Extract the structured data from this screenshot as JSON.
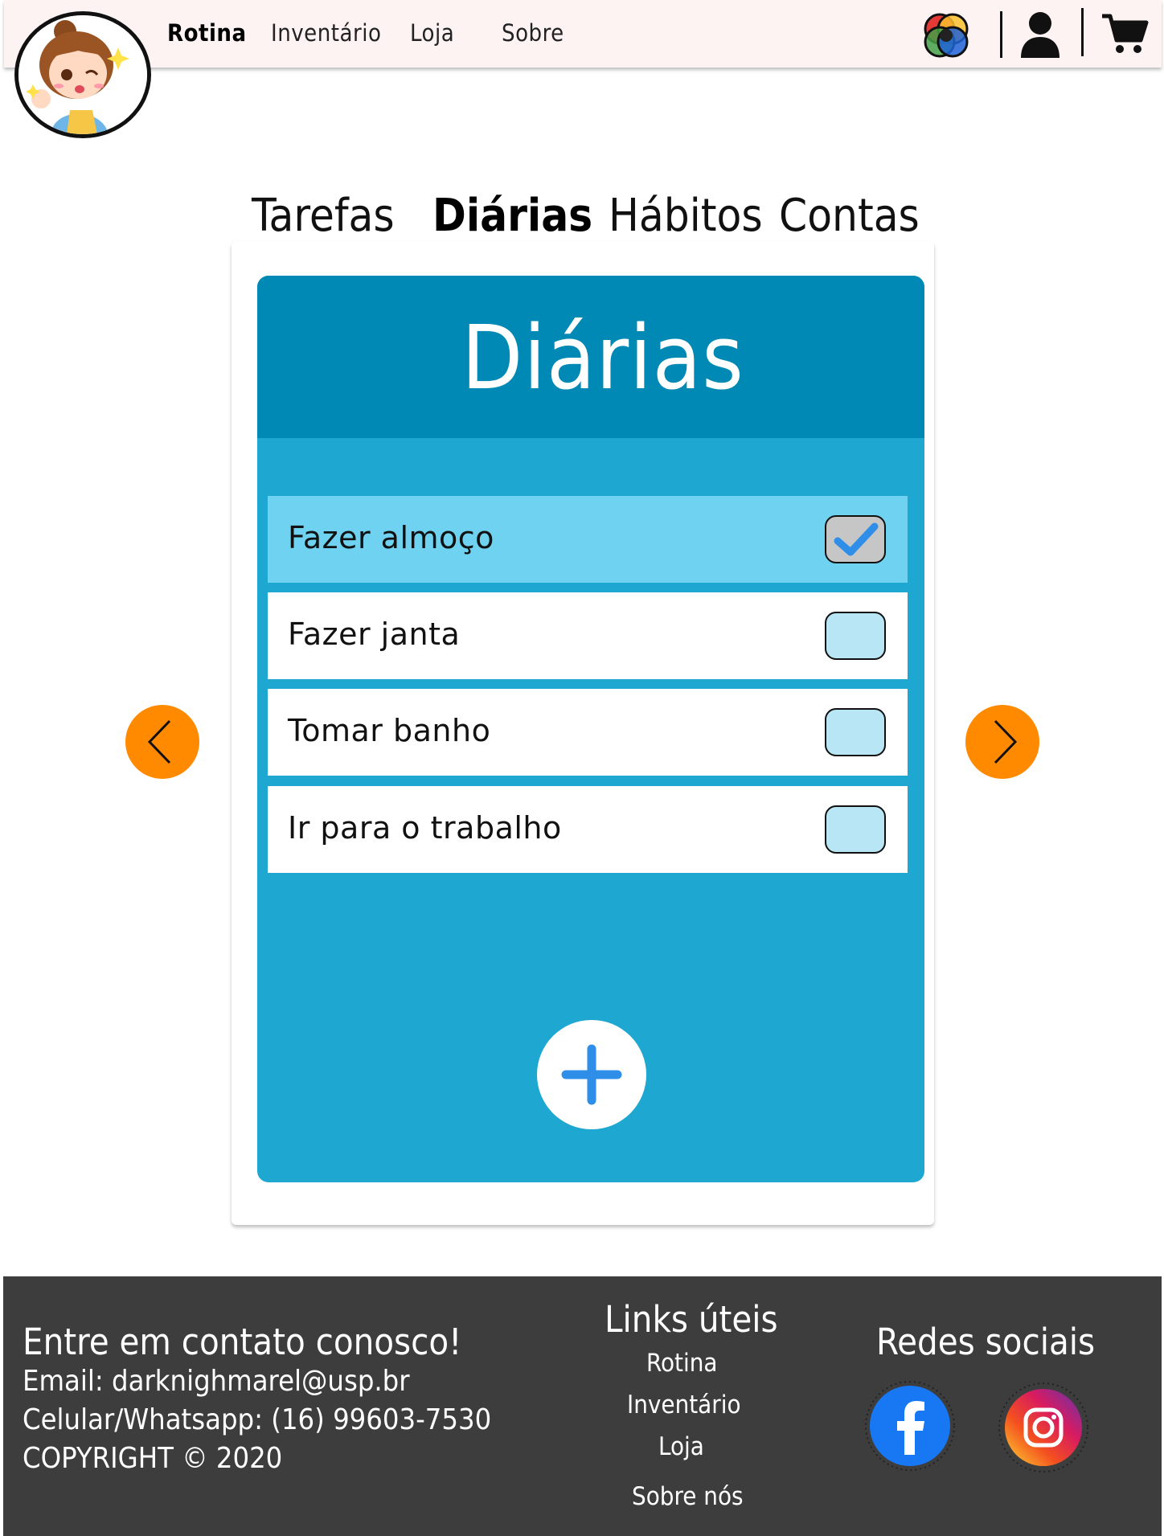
{
  "navbar": {
    "links": [
      {
        "label": "Rotina",
        "active": true
      },
      {
        "label": "Inventário",
        "active": false
      },
      {
        "label": "Loja",
        "active": false
      },
      {
        "label": "Sobre",
        "active": false
      }
    ],
    "icons": [
      "color-palette-icon",
      "user-icon",
      "cart-icon"
    ]
  },
  "tabs": [
    {
      "label": "Tarefas",
      "active": false
    },
    {
      "label": "Diárias",
      "active": true
    },
    {
      "label": "Hábitos",
      "active": false
    },
    {
      "label": "Contas",
      "active": false
    }
  ],
  "card": {
    "title": "Diárias",
    "tasks": [
      {
        "label": "Fazer almoço",
        "checked": true
      },
      {
        "label": "Fazer janta",
        "checked": false
      },
      {
        "label": "Tomar banho",
        "checked": false
      },
      {
        "label": "Ir para o trabalho",
        "checked": false
      }
    ],
    "add_icon": "plus-icon"
  },
  "navigation": {
    "prev_icon": "chevron-left-icon",
    "next_icon": "chevron-right-icon"
  },
  "footer": {
    "contact": {
      "title": "Entre em contato conosco!",
      "email": "Email: darknighmarel@usp.br",
      "phone": "Celular/Whatsapp: (16) 99603-7530",
      "copyright": "COPYRIGHT © 2020"
    },
    "links": {
      "title": "Links úteis",
      "items": [
        "Rotina",
        "Inventário",
        "Loja",
        "Sobre nós"
      ]
    },
    "social": {
      "title": "Redes sociais",
      "icons": [
        "facebook-icon",
        "instagram-icon"
      ]
    }
  },
  "colors": {
    "navbar_bg": "#fdf3f3",
    "card_header": "#0089b4",
    "card_body": "#1ea7d0",
    "checked_row": "#6ed2f0",
    "checkbox_empty": "#b9e6f4",
    "arrow_button": "#ff8a00",
    "footer_bg": "#3d3d3d",
    "check_blue": "#2e8ee8"
  }
}
